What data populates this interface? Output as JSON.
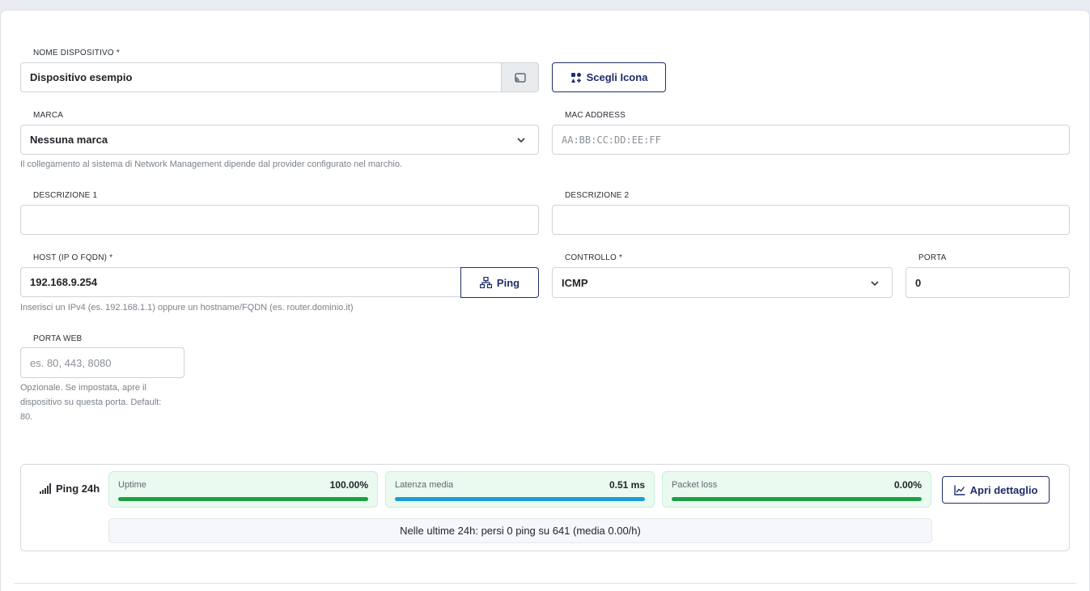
{
  "form": {
    "device_name": {
      "label": "NOME DISPOSITIVO *",
      "value": "Dispositivo esempio"
    },
    "choose_icon_label": "Scegli Icona",
    "brand": {
      "label": "MARCA",
      "value": "Nessuna marca",
      "help": "Il collegamento al sistema di Network Management dipende dal provider configurato nel marchio."
    },
    "mac": {
      "label": "MAC ADDRESS",
      "placeholder": "AA:BB:CC:DD:EE:FF"
    },
    "desc1": {
      "label": "DESCRIZIONE 1",
      "value": ""
    },
    "desc2": {
      "label": "DESCRIZIONE 2",
      "value": ""
    },
    "host": {
      "label": "HOST (IP O FQDN) *",
      "value": "192.168.9.254",
      "help": "Inserisci un IPv4 (es. 192.168.1.1) oppure un hostname/FQDN (es. router.dominio.it)"
    },
    "ping_label": "Ping",
    "control": {
      "label": "CONTROLLO *",
      "value": "ICMP"
    },
    "port": {
      "label": "PORTA",
      "value": "0"
    },
    "web_port": {
      "label": "PORTA WEB",
      "placeholder": "es. 80, 443, 8080",
      "help_lines": [
        "Opzionale. Se impostata, apre il",
        "dispositivo su questa porta. Default:",
        "80."
      ]
    }
  },
  "ping24h": {
    "title": "Ping 24h",
    "stats": [
      {
        "name": "Uptime",
        "value": "100.00%",
        "fill_pct": 100,
        "color": "#1e9e45"
      },
      {
        "name": "Latenza media",
        "value": "0.51 ms",
        "fill_pct": 100,
        "color": "#1f9bd8"
      },
      {
        "name": "Packet loss",
        "value": "0.00%",
        "fill_pct": 100,
        "color": "#1e9e45"
      }
    ],
    "detail_label": "Apri dettaglio",
    "summary": "Nelle ultime 24h: persi 0 ping su 641 (media 0.00/h)"
  },
  "colors": {
    "primary": "#1f2d6b",
    "success": "#1e9e45",
    "info": "#1f9bd8"
  }
}
